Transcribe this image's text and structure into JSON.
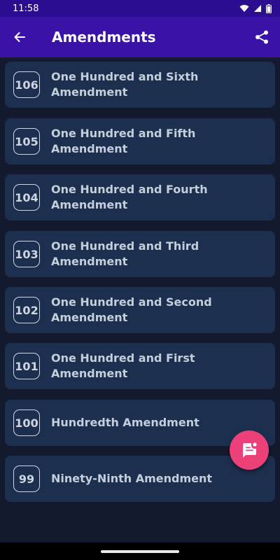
{
  "status_bar": {
    "time": "11:58"
  },
  "app_bar": {
    "title": "Amendments"
  },
  "amendments": [
    {
      "number": "106",
      "title": "One Hundred and Sixth\nAmendment"
    },
    {
      "number": "105",
      "title": "One Hundred and Fifth\nAmendment"
    },
    {
      "number": "104",
      "title": "One Hundred and Fourth\nAmendment"
    },
    {
      "number": "103",
      "title": "One Hundred and Third\nAmendment"
    },
    {
      "number": "102",
      "title": "One Hundred and Second\nAmendment"
    },
    {
      "number": "101",
      "title": "One Hundred and First\nAmendment"
    },
    {
      "number": "100",
      "title": "Hundredth Amendment"
    },
    {
      "number": "99",
      "title": "Ninety-Ninth Amendment"
    }
  ],
  "icons": {
    "back": "arrow-left-icon",
    "share": "share-icon",
    "fab": "chat-icon",
    "wifi": "wifi-icon",
    "signal": "signal-icon",
    "battery": "battery-icon"
  },
  "colors": {
    "status_bar": "#2a0e8f",
    "app_bar": "#3a12a8",
    "background": "#141a2e",
    "card": "#1c2f4e",
    "fab": "#ec4079"
  }
}
